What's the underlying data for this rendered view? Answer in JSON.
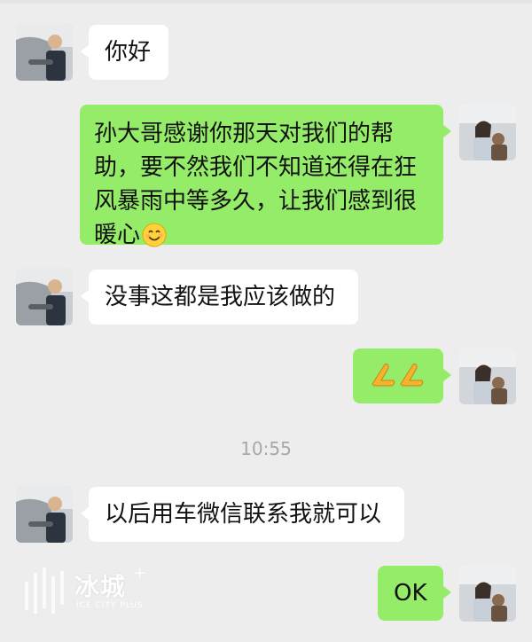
{
  "messages": [
    {
      "side": "in",
      "text": "你好"
    },
    {
      "side": "out",
      "text": "孙大哥感谢你那天对我们的帮助，要不然我们不知道还得在狂风暴雨中等多久，让我们感到很暖心",
      "emoji": "smiling-face-emoji"
    },
    {
      "side": "in",
      "text": "没事这都是我应该做的"
    },
    {
      "side": "out",
      "text": "",
      "emoji": "praying-hands-emoji"
    },
    {
      "side": "in",
      "text": "以后用车微信联系我就可以"
    },
    {
      "side": "out",
      "text": "OK"
    }
  ],
  "timestamp": "10:55",
  "watermark": {
    "main": "冰城",
    "plus": "+",
    "sub": "ICE CITY PLUS"
  },
  "colors": {
    "background": "#ededed",
    "incoming_bubble": "#ffffff",
    "outgoing_bubble": "#95ec69",
    "timestamp": "#a8a8a8"
  }
}
